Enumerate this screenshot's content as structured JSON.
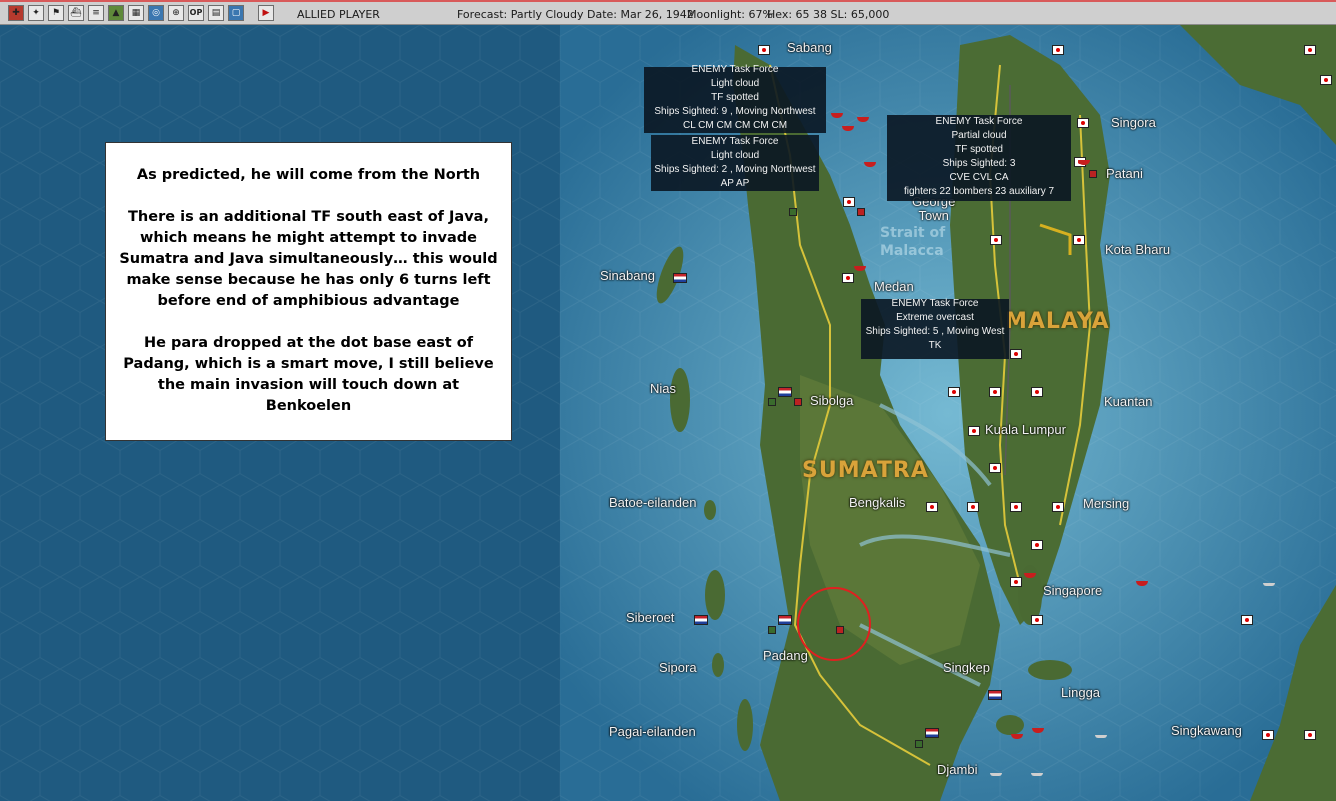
{
  "topbar": {
    "icons": [
      "flag-red-icon",
      "ground-units-icon",
      "air-units-icon",
      "flag-icon",
      "ship-icon",
      "ship-list-icon",
      "terrain-icon",
      "grid-icon",
      "globe-icon",
      "target-icon",
      "op-icon",
      "report-icon",
      "window-icon",
      "end-turn-icon"
    ],
    "op_label": "OP",
    "player": "ALLIED PLAYER",
    "forecast": "Forecast: Partly Cloudy",
    "date": "Date: Mar 26, 1942",
    "moonlight": "Moonlight: 67%",
    "hex": "Hex: 65  38  SL: 65,000"
  },
  "map": {
    "labels": {
      "sabang": "Sabang",
      "singora": "Singora",
      "patani": "Patani",
      "george_town": "George\nTown",
      "kota_bharu": "Kota Bharu",
      "sinabang": "Sinabang",
      "medan": "Medan",
      "nias": "Nias",
      "sibolga": "Sibolga",
      "kuantan": "Kuantan",
      "kuala_lumpur": "Kuala Lumpur",
      "batoe": "Batoe-eilanden",
      "bengkalis": "Bengkalis",
      "mersing": "Mersing",
      "singapore": "Singapore",
      "siberoet": "Siberoet",
      "padang": "Padang",
      "sipora": "Sipora",
      "singkep": "Singkep",
      "lingga": "Lingga",
      "pagai": "Pagai-eilanden",
      "singkawang": "Singkawang",
      "djambi": "Djambi"
    },
    "regions": {
      "sumatra": "SUMATRA",
      "malaya": "MALAYA"
    },
    "water": {
      "strait": "Strait of\nMalacca"
    }
  },
  "task_forces": [
    {
      "lines": [
        "ENEMY Task Force",
        "Light cloud",
        "TF spotted",
        "Ships Sighted: 9 , Moving Northwest",
        "CL CM CM CM CM CM"
      ]
    },
    {
      "lines": [
        "ENEMY Task Force",
        "Light cloud",
        "Ships Sighted: 2 , Moving Northwest",
        "AP AP"
      ]
    },
    {
      "lines": [
        "ENEMY Task Force",
        "Partial cloud",
        "TF spotted",
        "Ships Sighted: 3",
        "CVE CVL CA",
        "fighters 22  bombers 23  auxiliary 7"
      ]
    },
    {
      "lines": [
        "ENEMY Task Force",
        "Extreme overcast",
        "Ships Sighted: 5 , Moving West",
        "TK"
      ]
    }
  ],
  "note": {
    "p1": "As predicted, he will come from the North",
    "p2": "There is an additional TF south east of Java, which means he might attempt to invade Sumatra and Java simultaneously… this would make sense because he has only 6 turns left before end of amphibious advantage",
    "p3": "He para dropped at the dot base east of Padang, which is a smart move, I still believe the main invasion will touch down at Benkoelen"
  },
  "colors": {
    "sea": "#1f5a80",
    "land": "#4d6b35",
    "highlight": "#e02020",
    "road": "#d6c23a"
  }
}
